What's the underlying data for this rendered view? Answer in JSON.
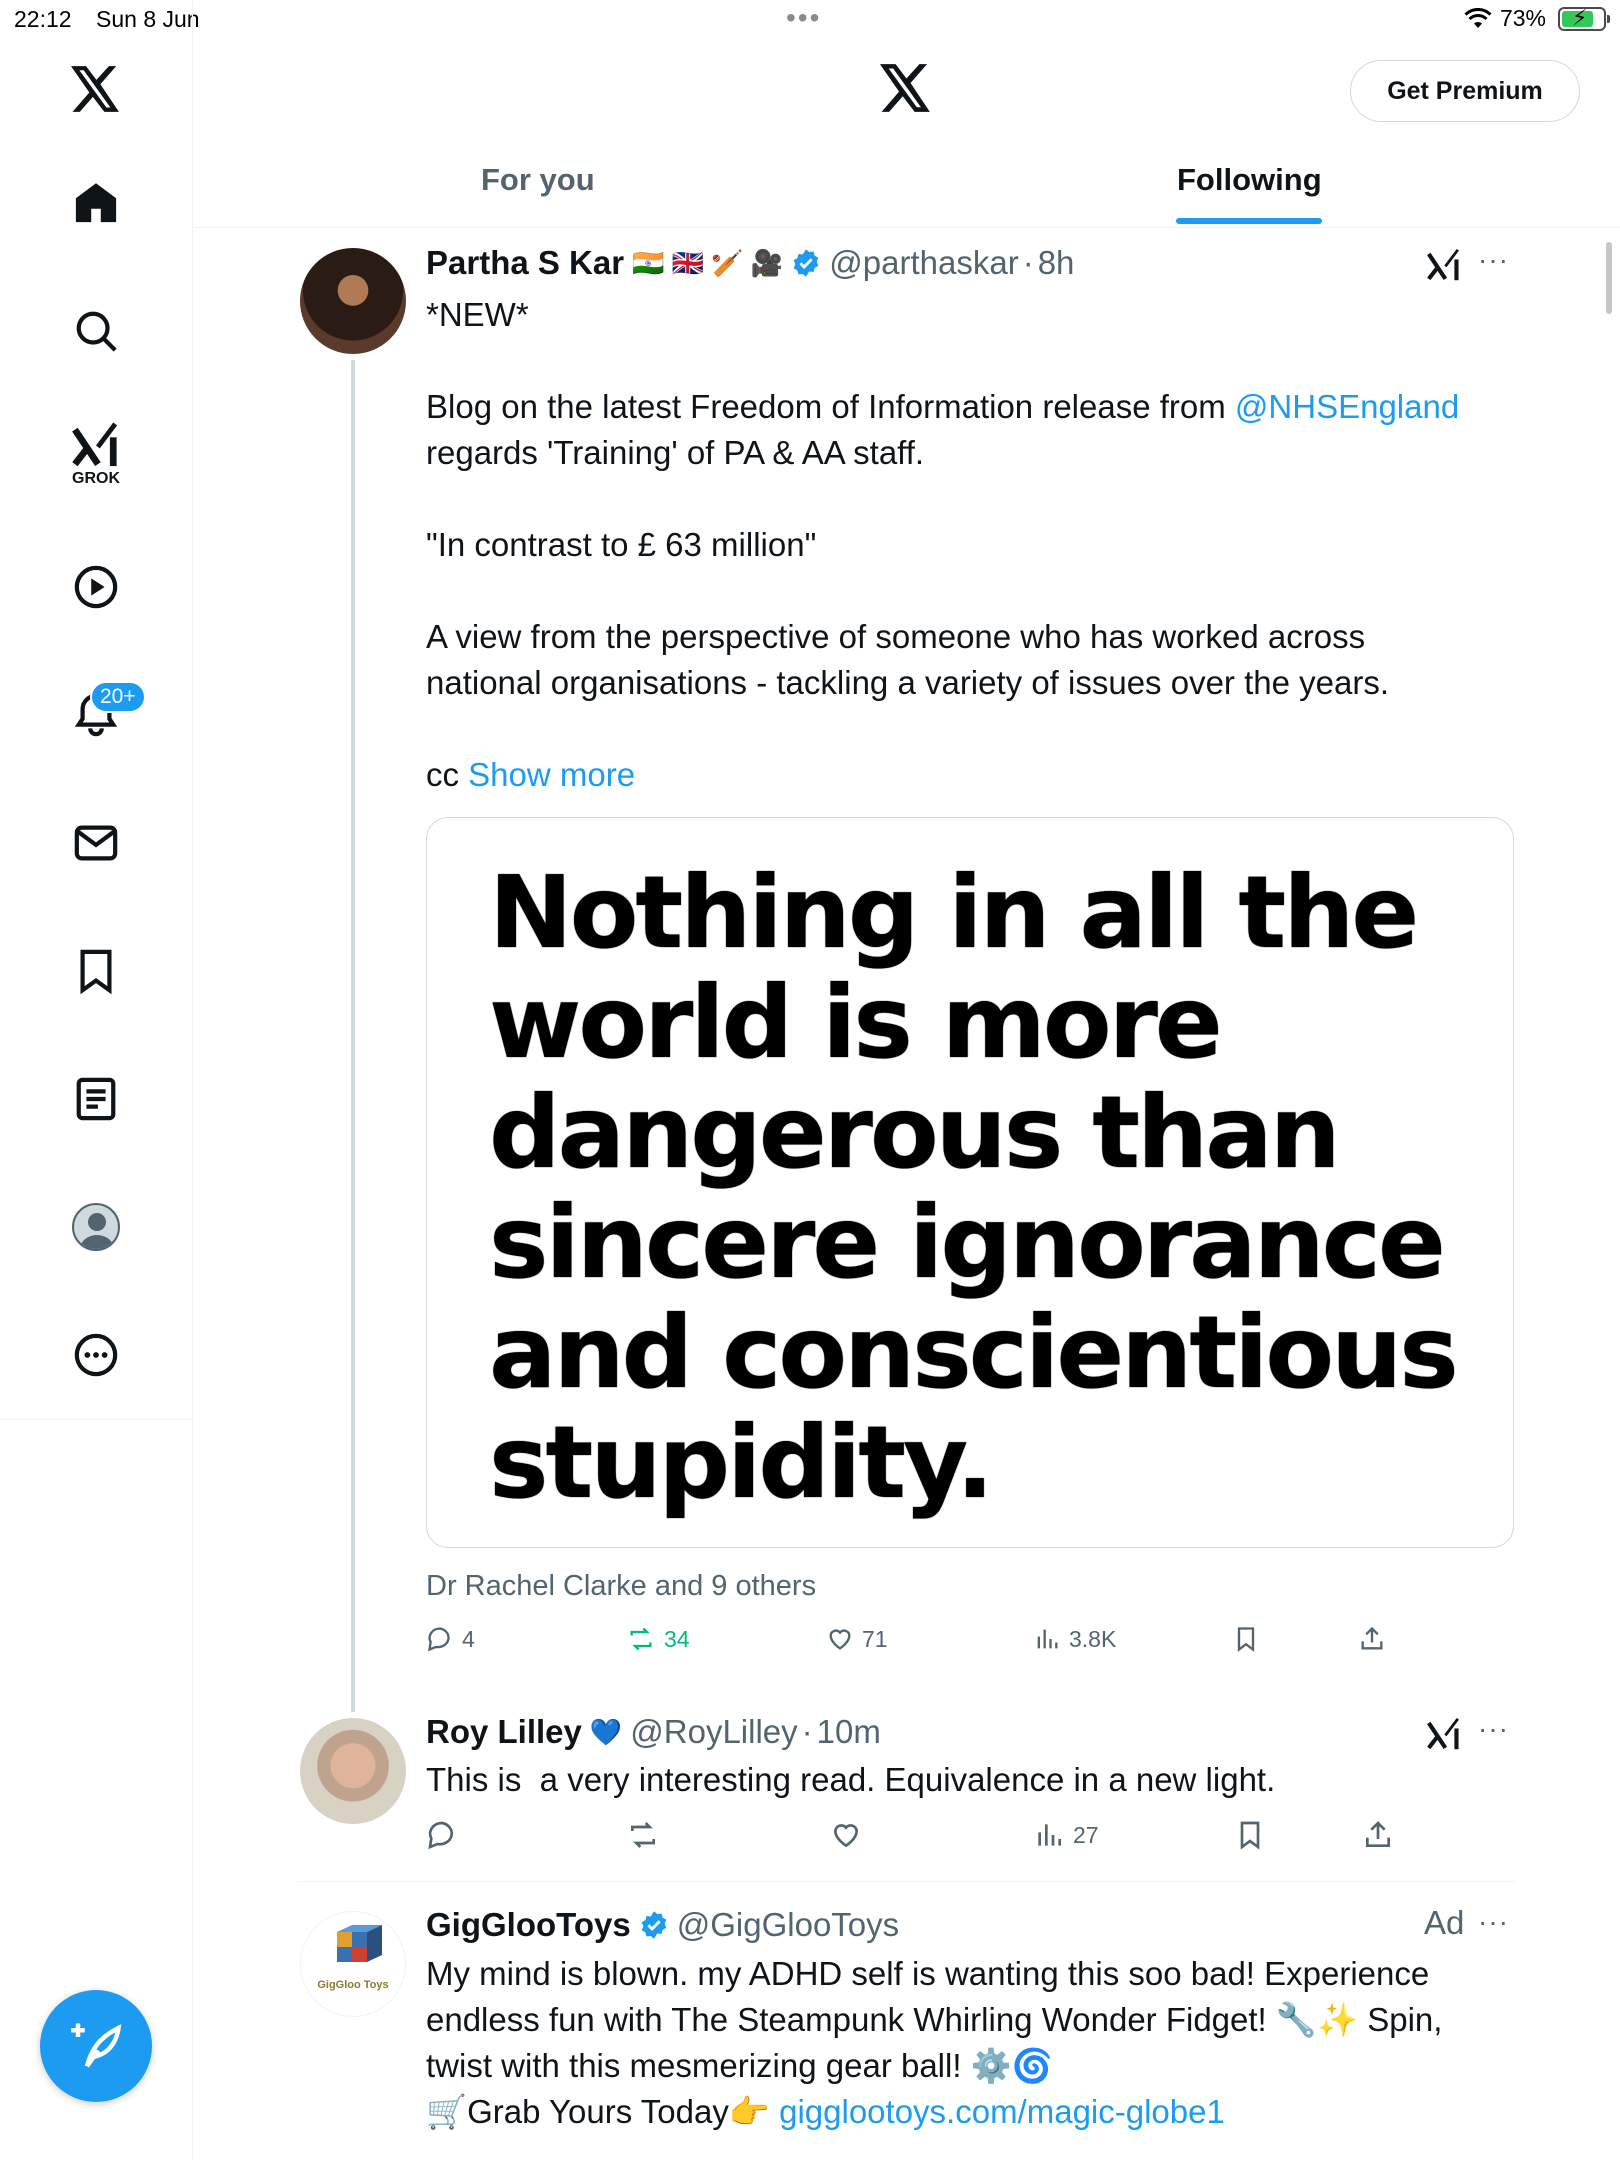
{
  "status_bar": {
    "time": "22:12",
    "date": "Sun 8 Jun",
    "battery": "73%"
  },
  "nav": {
    "grok_label": "GROK",
    "notifications_badge": "20+"
  },
  "header": {
    "premium_label": "Get Premium",
    "tabs": [
      {
        "label": "For you",
        "active": false
      },
      {
        "label": "Following",
        "active": true
      }
    ]
  },
  "tweets": [
    {
      "name": "Partha S Kar",
      "name_emoji": "🇮🇳 🇬🇧 🏏 🎥",
      "handle": "@parthaskar",
      "time": "8h",
      "text_intro": "*NEW*\n\nBlog on the latest Freedom of Information release from ",
      "mention": "@NHSEngland",
      "text_rest": "\nregards 'Training' of PA & AA staff.\n\n\"In contrast to £ 63 million\"\n\nA view from the perspective of someone who has worked across\nnational organisations - tackling a variety of issues over the years.\n\ncc ",
      "show_more": "Show more",
      "media_quote": "Nothing in all the world is more dangerous than sincere ignorance and conscientious stupidity.",
      "liked_by": "Dr Rachel Clarke and 9 others",
      "replies": "4",
      "reposts": "34",
      "likes": "71",
      "views": "3.8K"
    },
    {
      "name": "Roy Lilley",
      "name_emoji": "💙",
      "handle": "@RoyLilley",
      "time": "10m",
      "text": "This is  a very interesting read. Equivalence in a new light.",
      "views": "27"
    },
    {
      "name": "GigGlooToys",
      "handle": "@GigGlooToys",
      "ad_label": "Ad",
      "avatar_text": "GigGloo Toys",
      "text_main": "My mind is blown. my ADHD self is wanting this soo bad! Experience\nendless fun with The Steampunk Whirling Wonder Fidget! 🔧✨ Spin,\ntwist with this mesmerizing gear ball! ⚙️🌀\n🛒Grab Yours Today👉 ",
      "link": "gigglootoys.com/magic-globe1"
    }
  ],
  "colors": {
    "accent": "#1d9bf0",
    "repost_green": "#00ba7c",
    "muted": "#536471"
  }
}
